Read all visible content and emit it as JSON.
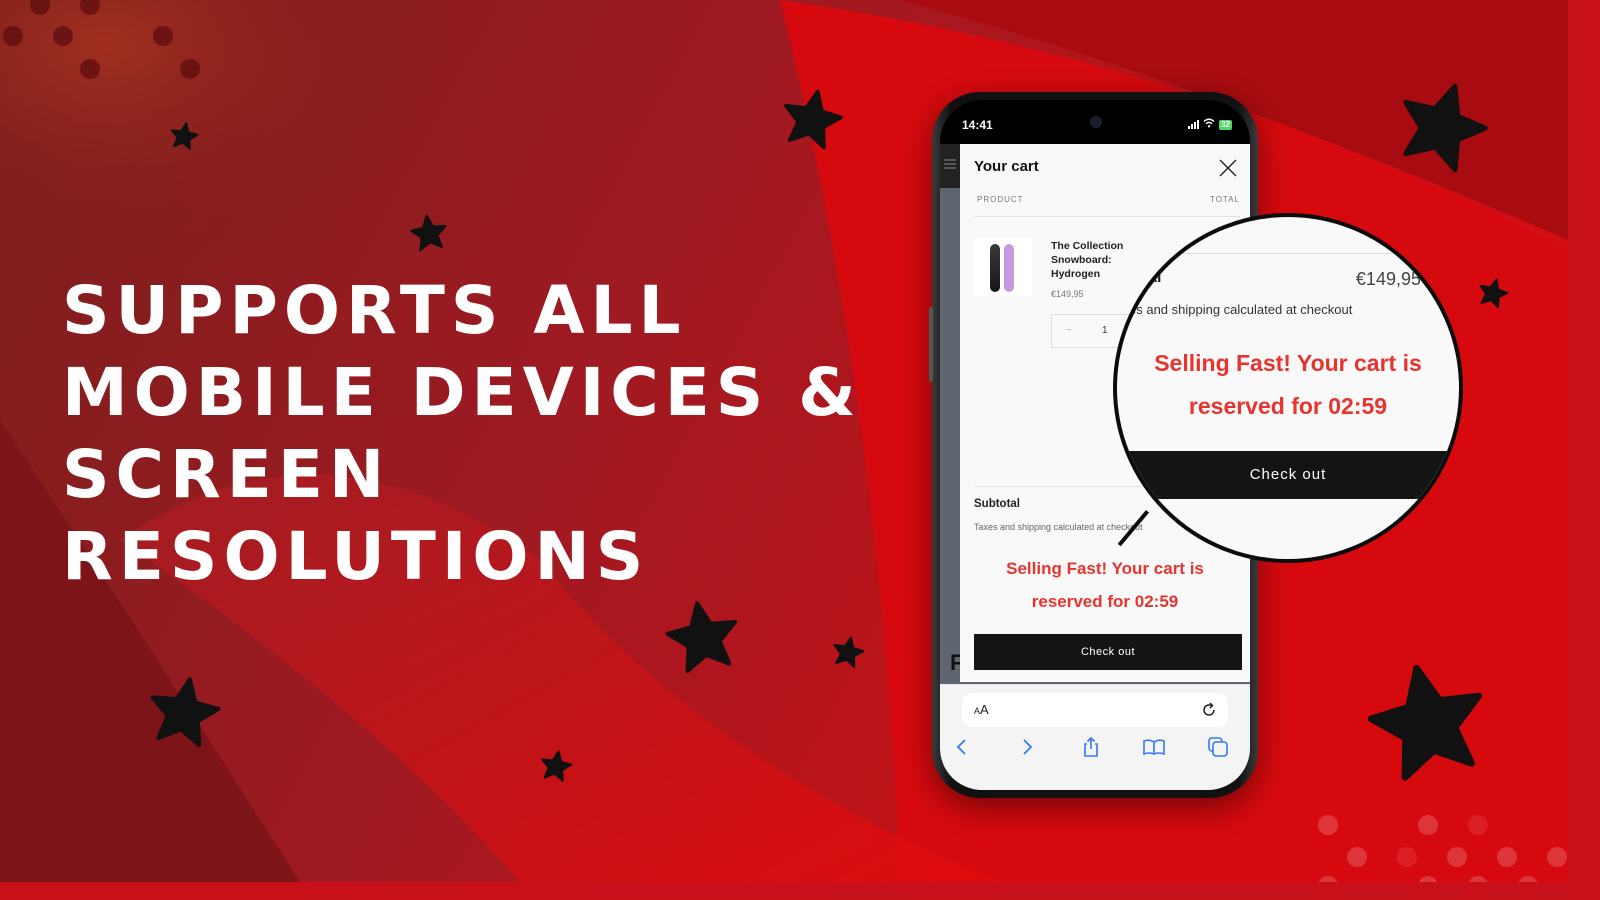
{
  "banner": {
    "headline_lines": [
      "Supports all",
      "mobile devices &",
      "screen",
      "resolutions"
    ],
    "colors": {
      "primary_red": "#d60a10",
      "dark_red": "#7a1a1e",
      "text_white": "#ffffff",
      "star_black": "#111111",
      "urgency_red": "#e8342f"
    }
  },
  "phone": {
    "status_bar": {
      "time": "14:41",
      "battery": "32"
    },
    "cart": {
      "title": "Your cart",
      "close_icon": "close-icon",
      "columns": {
        "product": "PRODUCT",
        "total": "TOTAL"
      },
      "items": [
        {
          "name": "The Collection Snowboard: Hydrogen",
          "price": "€149,95",
          "quantity": "1",
          "minus_label": "−"
        }
      ],
      "subtotal_label": "Subtotal",
      "subtotal_value": "€149,95",
      "tax_note": "Taxes and shipping calculated at checkout",
      "urgency_message_line1": "Selling Fast! Your cart is",
      "urgency_message_line2": "reserved for 02:59",
      "checkout_label": "Check out"
    },
    "browser": {
      "aa_small": "A",
      "aa_large": "A",
      "icons": [
        "back-icon",
        "forward-icon",
        "share-icon",
        "bookmarks-icon",
        "tabs-icon"
      ]
    },
    "site_fragment_letter": "F"
  },
  "magnifier": {
    "subtotal_label": "otal",
    "subtotal_value": "€149,95",
    "tax_note": "es and shipping calculated at checkout",
    "urgency_message_line1": "Selling Fast! Your cart is",
    "urgency_message_line2": "reserved for 02:59",
    "checkout_label": "Check out"
  }
}
